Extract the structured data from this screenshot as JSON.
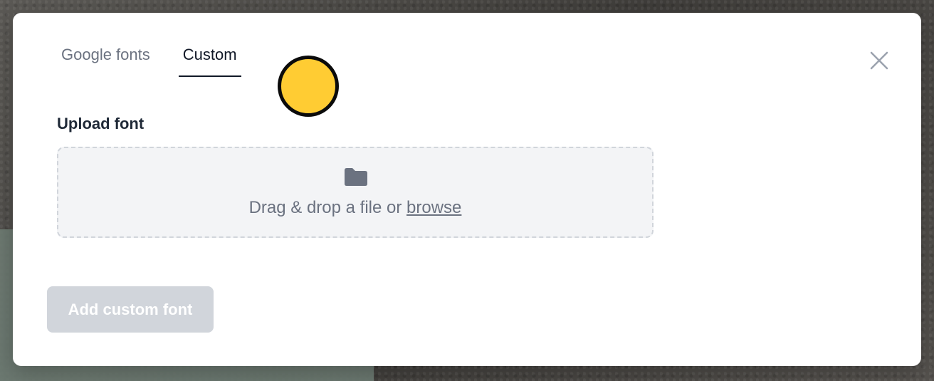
{
  "tabs": [
    {
      "label": "Google fonts",
      "active": false
    },
    {
      "label": "Custom",
      "active": true
    }
  ],
  "upload": {
    "label": "Upload font",
    "drop_text": "Drag & drop a file or ",
    "browse_label": "browse",
    "icon": "folder-icon"
  },
  "actions": {
    "add_label": "Add custom font",
    "add_enabled": false
  },
  "close": {
    "icon": "close-icon"
  },
  "colors": {
    "accent": "#111827",
    "muted": "#6b7280",
    "disabled_button": "#d1d5db",
    "cursor_marker": "#ffcc33"
  }
}
